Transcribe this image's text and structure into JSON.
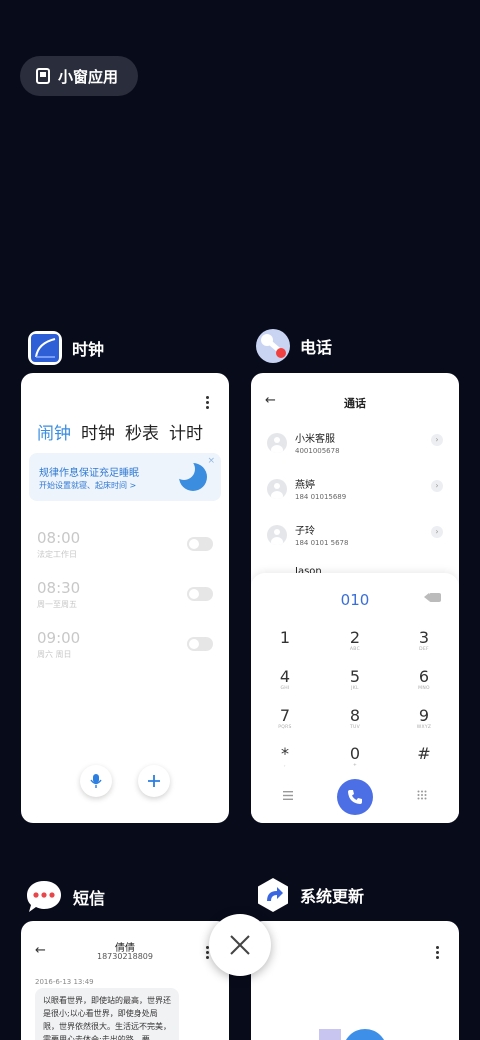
{
  "floating_pill": {
    "label": "小窗应用"
  },
  "clock_app": {
    "name": "时钟",
    "tabs": [
      "闹钟",
      "时钟",
      "秒表",
      "计时"
    ],
    "banner": {
      "title": "规律作息保证充足睡眠",
      "subtitle": "开始设置就寝、起床时间 >",
      "close": "×"
    },
    "alarms": [
      {
        "time": "08:00",
        "label": "法定工作日"
      },
      {
        "time": "08:30",
        "label": "周一至周五"
      },
      {
        "time": "09:00",
        "label": "周六 周日"
      }
    ]
  },
  "phone_app": {
    "name": "电话",
    "title": "通话",
    "contacts": [
      {
        "name": "小米客服",
        "number": "4001005678"
      },
      {
        "name": "燕婷",
        "number": "184 01015689"
      },
      {
        "name": "子玲",
        "number": "184 0101 5678"
      },
      {
        "name": "Jason",
        "number": ""
      }
    ],
    "dial_number": "010",
    "keys": [
      {
        "digit": "1",
        "letters": ""
      },
      {
        "digit": "2",
        "letters": "ABC"
      },
      {
        "digit": "3",
        "letters": "DEF"
      },
      {
        "digit": "4",
        "letters": "GHI"
      },
      {
        "digit": "5",
        "letters": "JKL"
      },
      {
        "digit": "6",
        "letters": "MNO"
      },
      {
        "digit": "7",
        "letters": "PQRS"
      },
      {
        "digit": "8",
        "letters": "TUV"
      },
      {
        "digit": "9",
        "letters": "WXYZ"
      },
      {
        "digit": "*",
        "letters": ","
      },
      {
        "digit": "0",
        "letters": "+"
      },
      {
        "digit": "#",
        "letters": ""
      }
    ]
  },
  "sms_app": {
    "name": "短信",
    "contact_name": "倩倩",
    "contact_number": "18730218809",
    "timestamp": "2016-6-13 13:49",
    "message": "以眼看世界，即使站的最高，世界还是很小;以心看世界，即使身处局限，世界依然很大。生活远不完美，需要用心去体会;走出的路，要..."
  },
  "update_app": {
    "name": "系统更新"
  },
  "colors": {
    "background": "#080b1a",
    "accent_blue": "#3a8ddf",
    "call_blue": "#4c6fe6",
    "sms_red": "#e8464a"
  }
}
